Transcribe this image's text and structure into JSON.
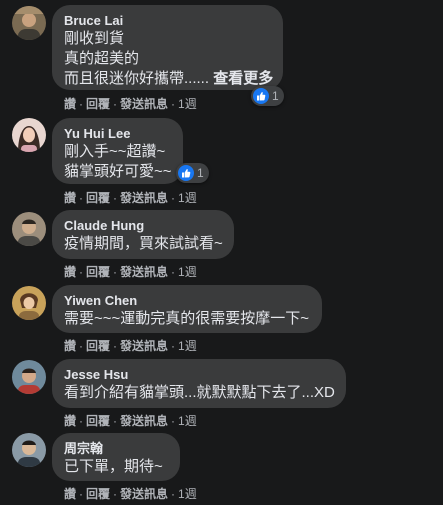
{
  "comments": [
    {
      "author": "Bruce Lai",
      "lines": [
        "剛收到貨",
        "真的超美的",
        "而且很迷你好攜帶......"
      ],
      "see_more": "查看更多",
      "actions": {
        "like": "讚",
        "reply": "回覆",
        "message": "發送訊息",
        "time": "1週"
      },
      "reaction_count": "1",
      "avatar_icon": "user-avatar-icon"
    },
    {
      "author": "Yu Hui Lee",
      "lines": [
        "剛入手~~超讚~",
        "貓掌頭好可愛~~"
      ],
      "actions": {
        "like": "讚",
        "reply": "回覆",
        "message": "發送訊息",
        "time": "1週"
      },
      "reaction_count": "1",
      "avatar_icon": "user-avatar-icon"
    },
    {
      "author": "Claude Hung",
      "lines": [
        "疫情期間，買來試試看~"
      ],
      "actions": {
        "like": "讚",
        "reply": "回覆",
        "message": "發送訊息",
        "time": "1週"
      },
      "avatar_icon": "user-avatar-icon"
    },
    {
      "author": "Yiwen Chen",
      "lines": [
        "需要~~~運動完真的很需要按摩一下~"
      ],
      "actions": {
        "like": "讚",
        "reply": "回覆",
        "message": "發送訊息",
        "time": "1週"
      },
      "avatar_icon": "user-avatar-icon"
    },
    {
      "author": "Jesse Hsu",
      "lines": [
        "看到介紹有貓掌頭...就默默點下去了...XD"
      ],
      "actions": {
        "like": "讚",
        "reply": "回覆",
        "message": "發送訊息",
        "time": "1週"
      },
      "avatar_icon": "user-avatar-icon"
    },
    {
      "author": "周宗翰",
      "lines": [
        "已下單，期待~"
      ],
      "actions": {
        "like": "讚",
        "reply": "回覆",
        "message": "發送訊息",
        "time": "1週"
      },
      "avatar_icon": "user-avatar-icon"
    }
  ],
  "colors": {
    "background": "#18191a",
    "bubble": "#3a3b3c",
    "text": "#e4e6eb",
    "secondary_text": "#b0b3b8",
    "like_blue": "#1877f2"
  }
}
